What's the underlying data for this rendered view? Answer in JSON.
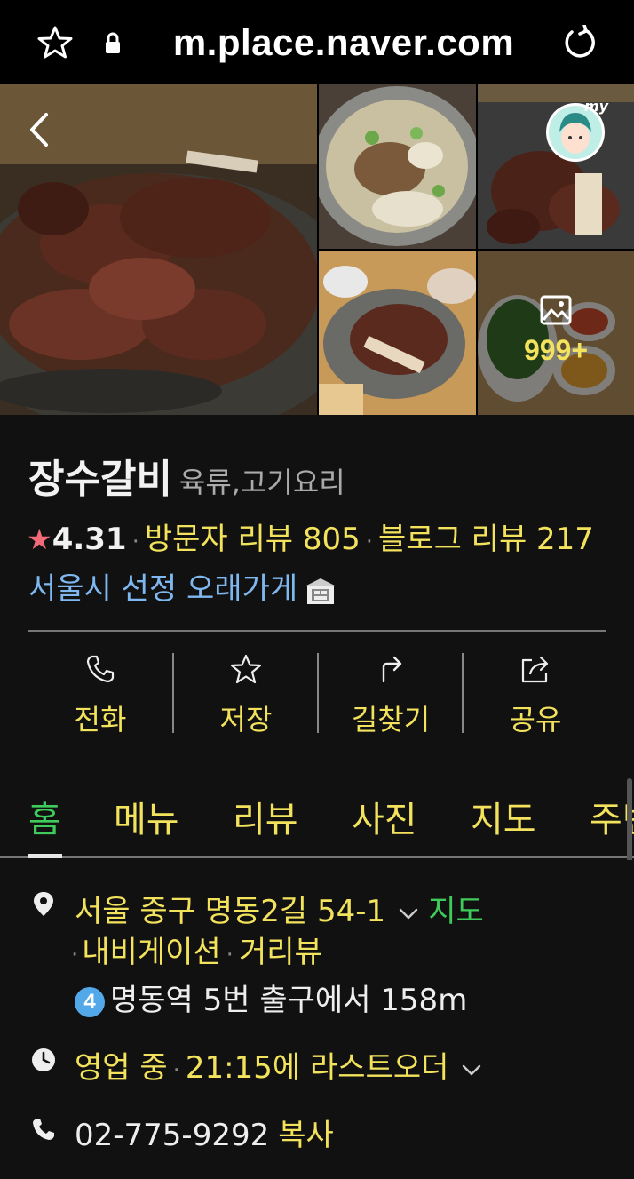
{
  "browser": {
    "url": "m.place.naver.com",
    "icons": [
      "star-icon",
      "lock-icon",
      "reload-icon"
    ]
  },
  "photos": {
    "more_count": "999+",
    "icons": [
      "back-arrow-icon",
      "my-avatar-icon",
      "gallery-icon"
    ]
  },
  "place": {
    "name": "장수갈비",
    "category": "육류,고기요리",
    "rating_star": "★",
    "rating": "4.31",
    "separator": "·",
    "visitor_reviews": "방문자 리뷰 805",
    "blog_reviews": "블로그 리뷰 217",
    "badge": "서울시 선정 오래가게",
    "colors": {
      "accent_yellow": "#f2e25c",
      "accent_green": "#3ecb5b",
      "badge_blue": "#7fb8f0",
      "star_pink": "#f26b78"
    }
  },
  "actions": [
    {
      "label": "전화",
      "icon": "phone-icon"
    },
    {
      "label": "저장",
      "icon": "star-outline-icon"
    },
    {
      "label": "길찾기",
      "icon": "directions-icon"
    },
    {
      "label": "공유",
      "icon": "share-icon"
    }
  ],
  "tabs": [
    {
      "label": "홈",
      "active": true
    },
    {
      "label": "메뉴"
    },
    {
      "label": "리뷰"
    },
    {
      "label": "사진"
    },
    {
      "label": "지도"
    },
    {
      "label": "주변"
    }
  ],
  "details": {
    "address": "서울 중구 명동2길 54-1",
    "map_link": "지도",
    "navigation_link": "내비게이션",
    "streetview_link": "거리뷰",
    "bullet": "·",
    "subway_line": "4",
    "subway_info": "명동역 5번 출구에서 158m",
    "hours_status": "영업 중",
    "last_order": "21:15에 라스트오더",
    "phone": "02-775-9292",
    "copy_label": "복사"
  }
}
